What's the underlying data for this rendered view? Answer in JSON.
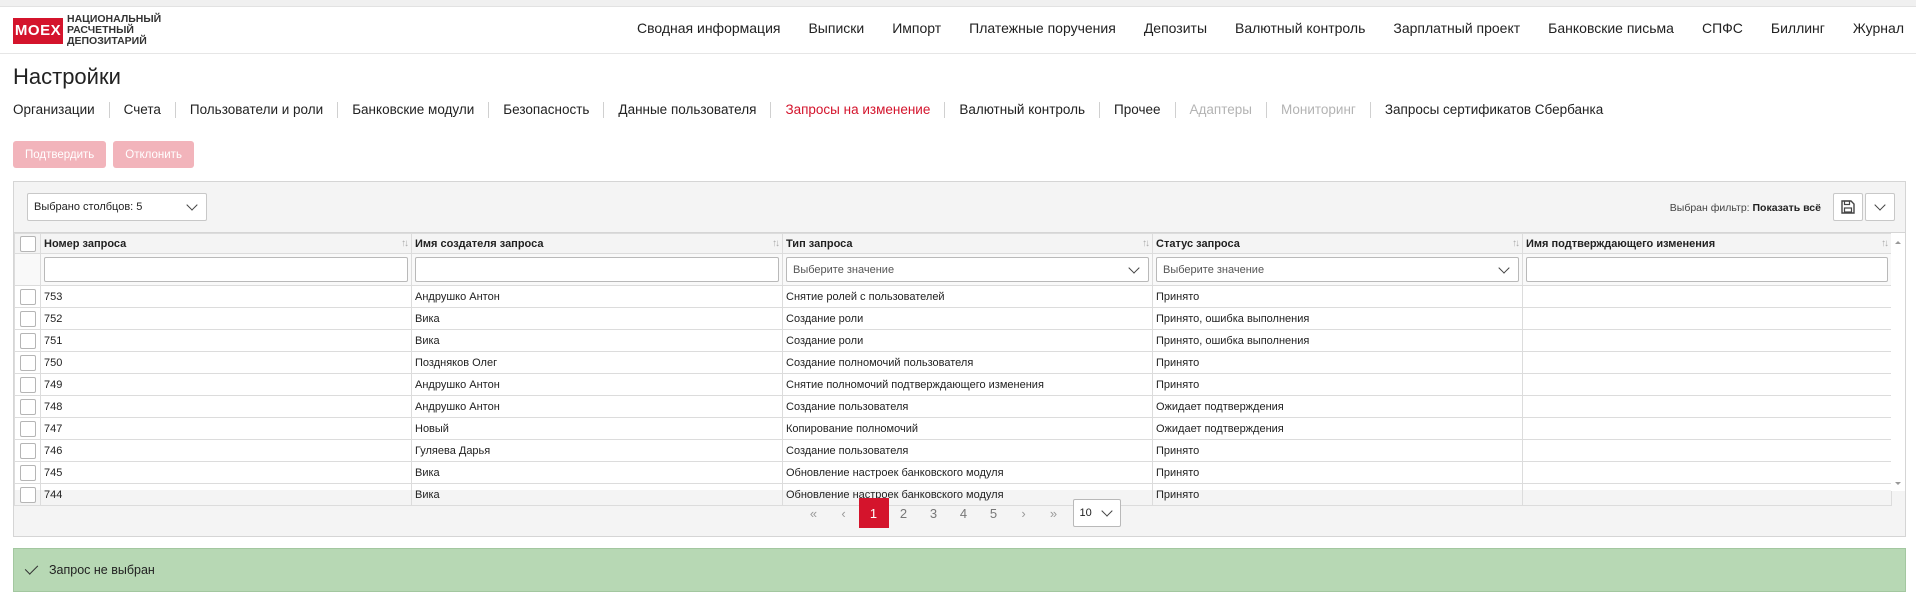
{
  "logo": {
    "mark": "MOEX",
    "line1": "НАЦИОНАЛЬНЫЙ",
    "line2": "РАСЧЕТНЫЙ",
    "line3": "ДЕПОЗИТАРИЙ"
  },
  "nav": {
    "items": [
      "Сводная информация",
      "Выписки",
      "Импорт",
      "Платежные поручения",
      "Депозиты",
      "Валютный контроль",
      "Зарплатный проект",
      "Банковские письма",
      "СПФС",
      "Биллинг",
      "Журнал"
    ]
  },
  "page": {
    "title": "Настройки"
  },
  "tabs": [
    {
      "label": "Организации",
      "state": "normal"
    },
    {
      "label": "Счета",
      "state": "normal"
    },
    {
      "label": "Пользователи и роли",
      "state": "normal"
    },
    {
      "label": "Банковские модули",
      "state": "normal"
    },
    {
      "label": "Безопасность",
      "state": "normal"
    },
    {
      "label": "Данные пользователя",
      "state": "normal"
    },
    {
      "label": "Запросы на изменение",
      "state": "active"
    },
    {
      "label": "Валютный контроль",
      "state": "normal"
    },
    {
      "label": "Прочее",
      "state": "normal"
    },
    {
      "label": "Адаптеры",
      "state": "disabled"
    },
    {
      "label": "Мониторинг",
      "state": "disabled"
    },
    {
      "label": "Запросы сертификатов Сбербанка",
      "state": "normal"
    }
  ],
  "actions": {
    "confirm_label": "Подтвердить",
    "reject_label": "Отклонить"
  },
  "toolbar": {
    "columns_selected": "Выбрано столбцов: 5",
    "filter_prefix": "Выбран фильтр:",
    "filter_value": "Показать всё",
    "save_icon": "save-icon",
    "menu_icon": "chevron-down-icon"
  },
  "table": {
    "columns": [
      "Номер запроса",
      "Имя создателя запроса",
      "Тип запроса",
      "Статус запроса",
      "Имя подтверждающего изменения"
    ],
    "filter_placeholder": "Выберите значение",
    "rows": [
      [
        "753",
        "Андрушко Антон",
        "Снятие ролей с пользователей",
        "Принято",
        ""
      ],
      [
        "752",
        "Вика",
        "Создание роли",
        "Принято, ошибка выполнения",
        ""
      ],
      [
        "751",
        "Вика",
        "Создание роли",
        "Принято, ошибка выполнения",
        ""
      ],
      [
        "750",
        "Поздняков Олег",
        "Создание полномочий пользователя",
        "Принято",
        ""
      ],
      [
        "749",
        "Андрушко Антон",
        "Снятие полномочий подтверждающего изменения",
        "Принято",
        ""
      ],
      [
        "748",
        "Андрушко Антон",
        "Создание пользователя",
        "Ожидает подтверждения",
        ""
      ],
      [
        "747",
        "Новый",
        "Копирование полномочий",
        "Ожидает подтверждения",
        ""
      ],
      [
        "746",
        "Гуляева Дарья",
        "Создание пользователя",
        "Принято",
        ""
      ],
      [
        "745",
        "Вика",
        "Обновление настроек банковского модуля",
        "Принято",
        ""
      ],
      [
        "744",
        "Вика",
        "Обновление настроек банковского модуля",
        "Принято",
        ""
      ]
    ]
  },
  "pagination": {
    "pages": [
      "1",
      "2",
      "3",
      "4",
      "5"
    ],
    "current": "1",
    "first": "«",
    "prev": "‹",
    "next": "›",
    "last": "»",
    "per_page": "10"
  },
  "notice": {
    "text": "Запрос не выбран"
  },
  "colors": {
    "accent": "#d4142c",
    "notice_bg": "#b7d8b4",
    "disabled_btn": "#f2b4bb"
  }
}
